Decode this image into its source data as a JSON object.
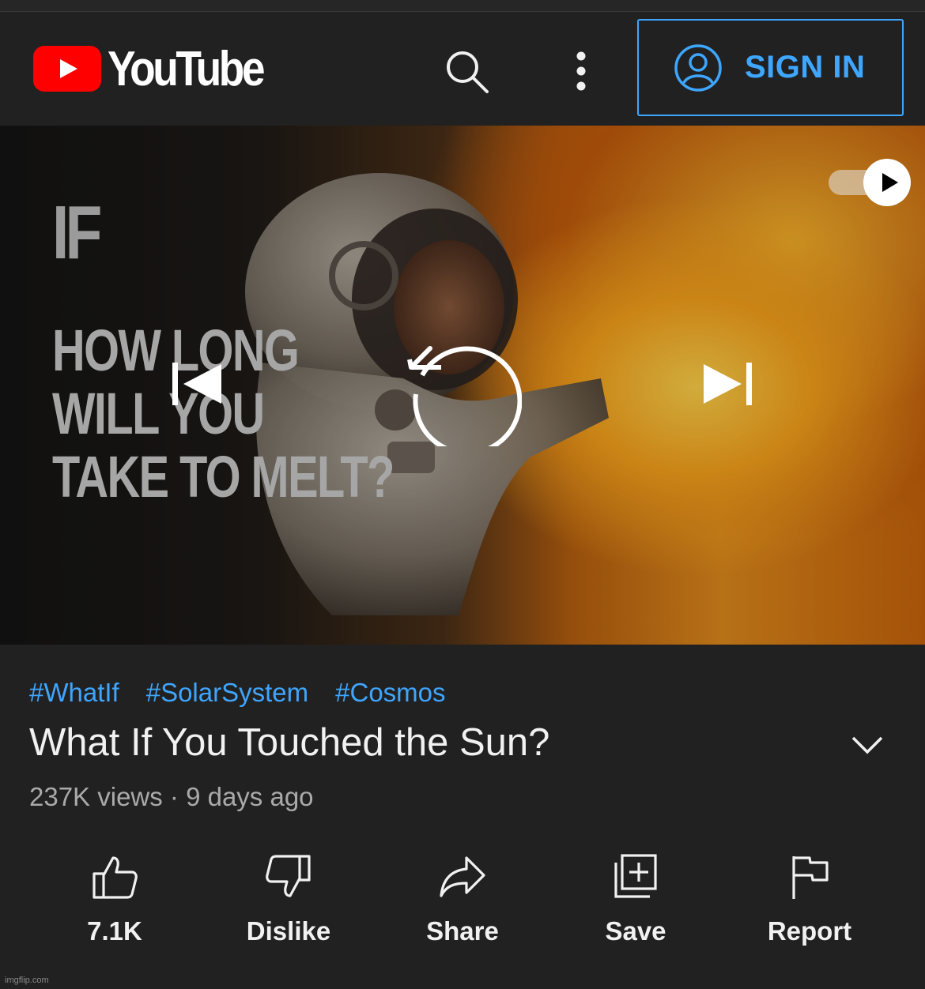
{
  "header": {
    "logo_text": "YouTube",
    "signin_label": "SIGN IN",
    "icons": [
      "youtube-logo",
      "search-icon",
      "more-vert-icon",
      "account-circle-icon"
    ]
  },
  "player": {
    "thumbnail_text": {
      "logo": "IF",
      "line1": "HOW LONG",
      "line2": "WILL YOU",
      "line3": "TAKE TO MELT?"
    },
    "controls": [
      "autoplay-toggle",
      "previous-icon",
      "replay-icon",
      "next-icon"
    ],
    "autoplay_on": true
  },
  "video": {
    "hashtags": [
      "#WhatIf",
      "#SolarSystem",
      "#Cosmos"
    ],
    "title": "What If You Touched the Sun?",
    "meta": "237K views · 9 days ago"
  },
  "actions": [
    {
      "label": "7.1K",
      "icon": "like-icon"
    },
    {
      "label": "Dislike",
      "icon": "dislike-icon"
    },
    {
      "label": "Share",
      "icon": "share-icon"
    },
    {
      "label": "Save",
      "icon": "save-playlist-icon"
    },
    {
      "label": "Report",
      "icon": "flag-icon"
    }
  ],
  "watermark": "imgflip.com",
  "colors": {
    "background": "#212121",
    "accent": "#3ea6ff",
    "brand_red": "#ff0000",
    "text": "#f1f1f1",
    "secondary_text": "#aaaaaa"
  }
}
